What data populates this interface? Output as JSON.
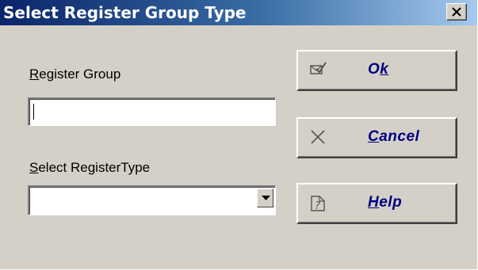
{
  "window": {
    "title": "Select Register Group Type"
  },
  "form": {
    "register_group_label_pre": "",
    "register_group_label_accel": "R",
    "register_group_label_post": "egister Group",
    "register_group_value": "",
    "register_type_label_pre": "",
    "register_type_label_accel": "S",
    "register_type_label_post": "elect RegisterType",
    "register_type_selected": ""
  },
  "buttons": {
    "ok_pre": "O",
    "ok_accel": "k",
    "ok_post": "",
    "cancel_pre": "",
    "cancel_accel": "C",
    "cancel_post": "ancel",
    "help_pre": "",
    "help_accel": "H",
    "help_post": "elp"
  },
  "icons": {
    "close": "close-icon",
    "ok": "checkmark-envelope-icon",
    "cancel": "x-icon",
    "help": "help-document-icon",
    "dropdown": "chevron-down-icon"
  }
}
